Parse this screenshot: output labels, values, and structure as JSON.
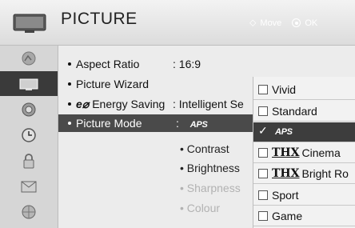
{
  "header": {
    "title": "PICTURE",
    "hint_move": "Move",
    "hint_ok": "OK",
    "icon": "tv-icon"
  },
  "sidebar": {
    "items": [
      {
        "icon": "picture-icon",
        "selected": false
      },
      {
        "icon": "tv-screen-icon",
        "selected": true
      },
      {
        "icon": "speaker-icon",
        "selected": false
      },
      {
        "icon": "clock-icon",
        "selected": false
      },
      {
        "icon": "lock-icon",
        "selected": false
      },
      {
        "icon": "options-icon",
        "selected": false
      },
      {
        "icon": "network-icon",
        "selected": false
      }
    ]
  },
  "menu": {
    "aspect_ratio": {
      "label": "Aspect Ratio",
      "value": ": 16:9"
    },
    "picture_wizard": {
      "label": "Picture Wizard"
    },
    "energy_saving": {
      "logo": "e⌀",
      "label": "Energy Saving",
      "value": ": Intelligent Se"
    },
    "picture_mode": {
      "label": "Picture Mode",
      "value_prefix": ":",
      "value_logo": "APS"
    },
    "contrast": "• Contrast",
    "brightness": "• Brightness",
    "sharpness": "• Sharpness",
    "colour": "• Colour"
  },
  "dropdown": {
    "options": [
      {
        "label": "Vivid",
        "checked": false
      },
      {
        "label": "Standard",
        "checked": false
      },
      {
        "label": "APS",
        "checked": true
      },
      {
        "prefix": "THX",
        "label": "Cinema",
        "checked": false
      },
      {
        "prefix": "THX",
        "label": "Bright Ro",
        "checked": false
      },
      {
        "label": "Sport",
        "checked": false
      },
      {
        "label": "Game",
        "checked": false
      }
    ]
  },
  "colors": {
    "selected_bg": "#3d3d3d",
    "panel_bg": "#ececec",
    "dim_text": "#b2b2b2"
  }
}
